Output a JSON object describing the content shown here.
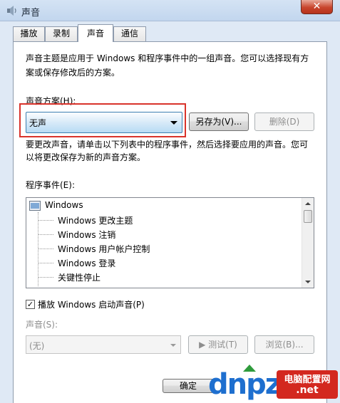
{
  "window": {
    "title": "声音",
    "close_symbol": "✕"
  },
  "tabs": [
    {
      "label": "播放"
    },
    {
      "label": "录制"
    },
    {
      "label": "声音"
    },
    {
      "label": "通信"
    }
  ],
  "intro_text_line1": "声音主题是应用于 Windows 和程序事件中的一组声音。您可以选择现有方",
  "intro_text_line2": "案或保存修改后的方案。",
  "scheme": {
    "label": "声音方案(H):",
    "selected": "无声",
    "save_as_label": "另存为(V)...",
    "delete_label": "删除(D)"
  },
  "change_text_line1": "要更改声音，请单击以下列表中的程序事件，然后选择要应用的声音。您可",
  "change_text_line2": "以将更改保存为新的声音方案。",
  "events": {
    "label": "程序事件(E):",
    "group": "Windows",
    "items": [
      "Windows 更改主题",
      "Windows 注销",
      "Windows 用户帐户控制",
      "Windows 登录",
      "关键性停止"
    ]
  },
  "startup_sound": {
    "label": "播放 Windows 启动声音(P)",
    "checked": true,
    "check_glyph": "✓"
  },
  "sound": {
    "label": "声音(S):",
    "selected": "(无)",
    "test_label": "▶ 测试(T)",
    "browse_label": "浏览(B)..."
  },
  "footer": {
    "ok_label": "确定"
  },
  "watermark": {
    "dnpz": "dnpz",
    "badge_top": "电脑配置网",
    "badge_bottom": ".net"
  }
}
